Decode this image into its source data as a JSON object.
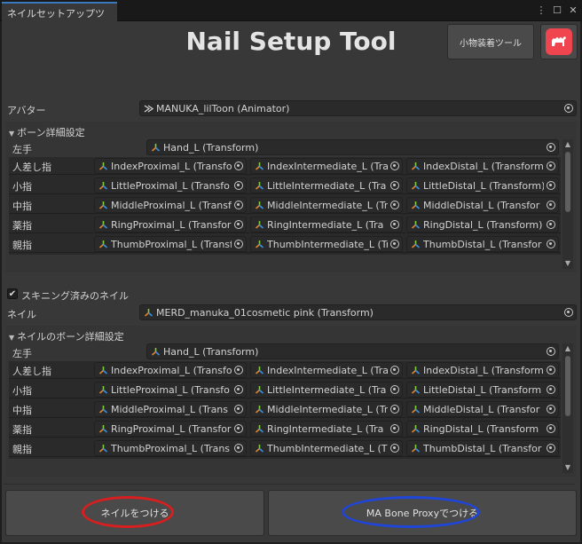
{
  "window": {
    "tab_title": "ネイルセットアップツール"
  },
  "header": {
    "title": "Nail Setup Tool",
    "side_button_label": "小物装着ツール",
    "logo_icon": "camel-logo-icon"
  },
  "colors": {
    "panel_bg": "#383838",
    "field_bg": "#2a2a2a",
    "logo_red": "#f0454f",
    "ring_red": "#d81e1e",
    "ring_blue": "#1f46d8"
  },
  "avatar": {
    "label": "アバター",
    "value": "MANUKA_lilToon (Animator)"
  },
  "bone_section": {
    "title": "ボーン詳細設定",
    "hand_label": "左手",
    "hand_value": "Hand_L (Transform)",
    "rows": [
      {
        "label": "人差し指",
        "cells": [
          "IndexProximal_L (Transfo",
          "IndexIntermediate_L (Tra",
          "IndexDistal_L (Transform"
        ]
      },
      {
        "label": "小指",
        "cells": [
          "LittleProximal_L (Transfo",
          "LittleIntermediate_L (Tra",
          "LittleDistal_L (Transform)"
        ]
      },
      {
        "label": "中指",
        "cells": [
          "MiddleProximal_L (Transf",
          "MiddleIntermediate_L (Tr",
          "MiddleDistal_L (Transfor"
        ]
      },
      {
        "label": "薬指",
        "cells": [
          "RingProximal_L (Transfor",
          "RingIntermediate_L (Tra",
          "RingDistal_L (Transform)"
        ]
      },
      {
        "label": "親指",
        "cells": [
          "ThumbProximal_L (Transfor",
          "ThumbIntermediate_L (Tr",
          "ThumbDistal_L (Transfor"
        ]
      }
    ]
  },
  "skinned": {
    "checked": true,
    "label": "スキニング済みのネイル"
  },
  "nail": {
    "label": "ネイル",
    "value": "MERD_manuka_01cosmetic pink (Transform)"
  },
  "nail_bone_section": {
    "title": "ネイルのボーン詳細設定",
    "hand_label": "左手",
    "hand_value": "Hand_L (Transform)",
    "rows": [
      {
        "label": "人差し指",
        "cells": [
          "IndexProximal_L (Transfo",
          "IndexIntermediate_L (Tra",
          "IndexDistal_L (Transform"
        ]
      },
      {
        "label": "小指",
        "cells": [
          "LittleProximal_L (Transfo",
          "LittleIntermediate_L (Tra",
          "LittleDistal_L (Transform"
        ]
      },
      {
        "label": "中指",
        "cells": [
          "MiddleProximal_L (Trans",
          "MiddleIntermediate_L (Tr",
          "MiddleDistal_L (Transfor"
        ]
      },
      {
        "label": "薬指",
        "cells": [
          "RingProximal_L (Transfor",
          "RingIntermediate_L (Tra",
          "RingDistal_L (Transform"
        ]
      },
      {
        "label": "親指",
        "cells": [
          "ThumbProximal_L (Trans",
          "ThumbIntermediate_L (T",
          "ThumbDistal_L (Transfor"
        ]
      }
    ]
  },
  "actions": {
    "attach_nail": "ネイルをつける",
    "attach_proxy": "MA Bone Proxyでつける"
  }
}
